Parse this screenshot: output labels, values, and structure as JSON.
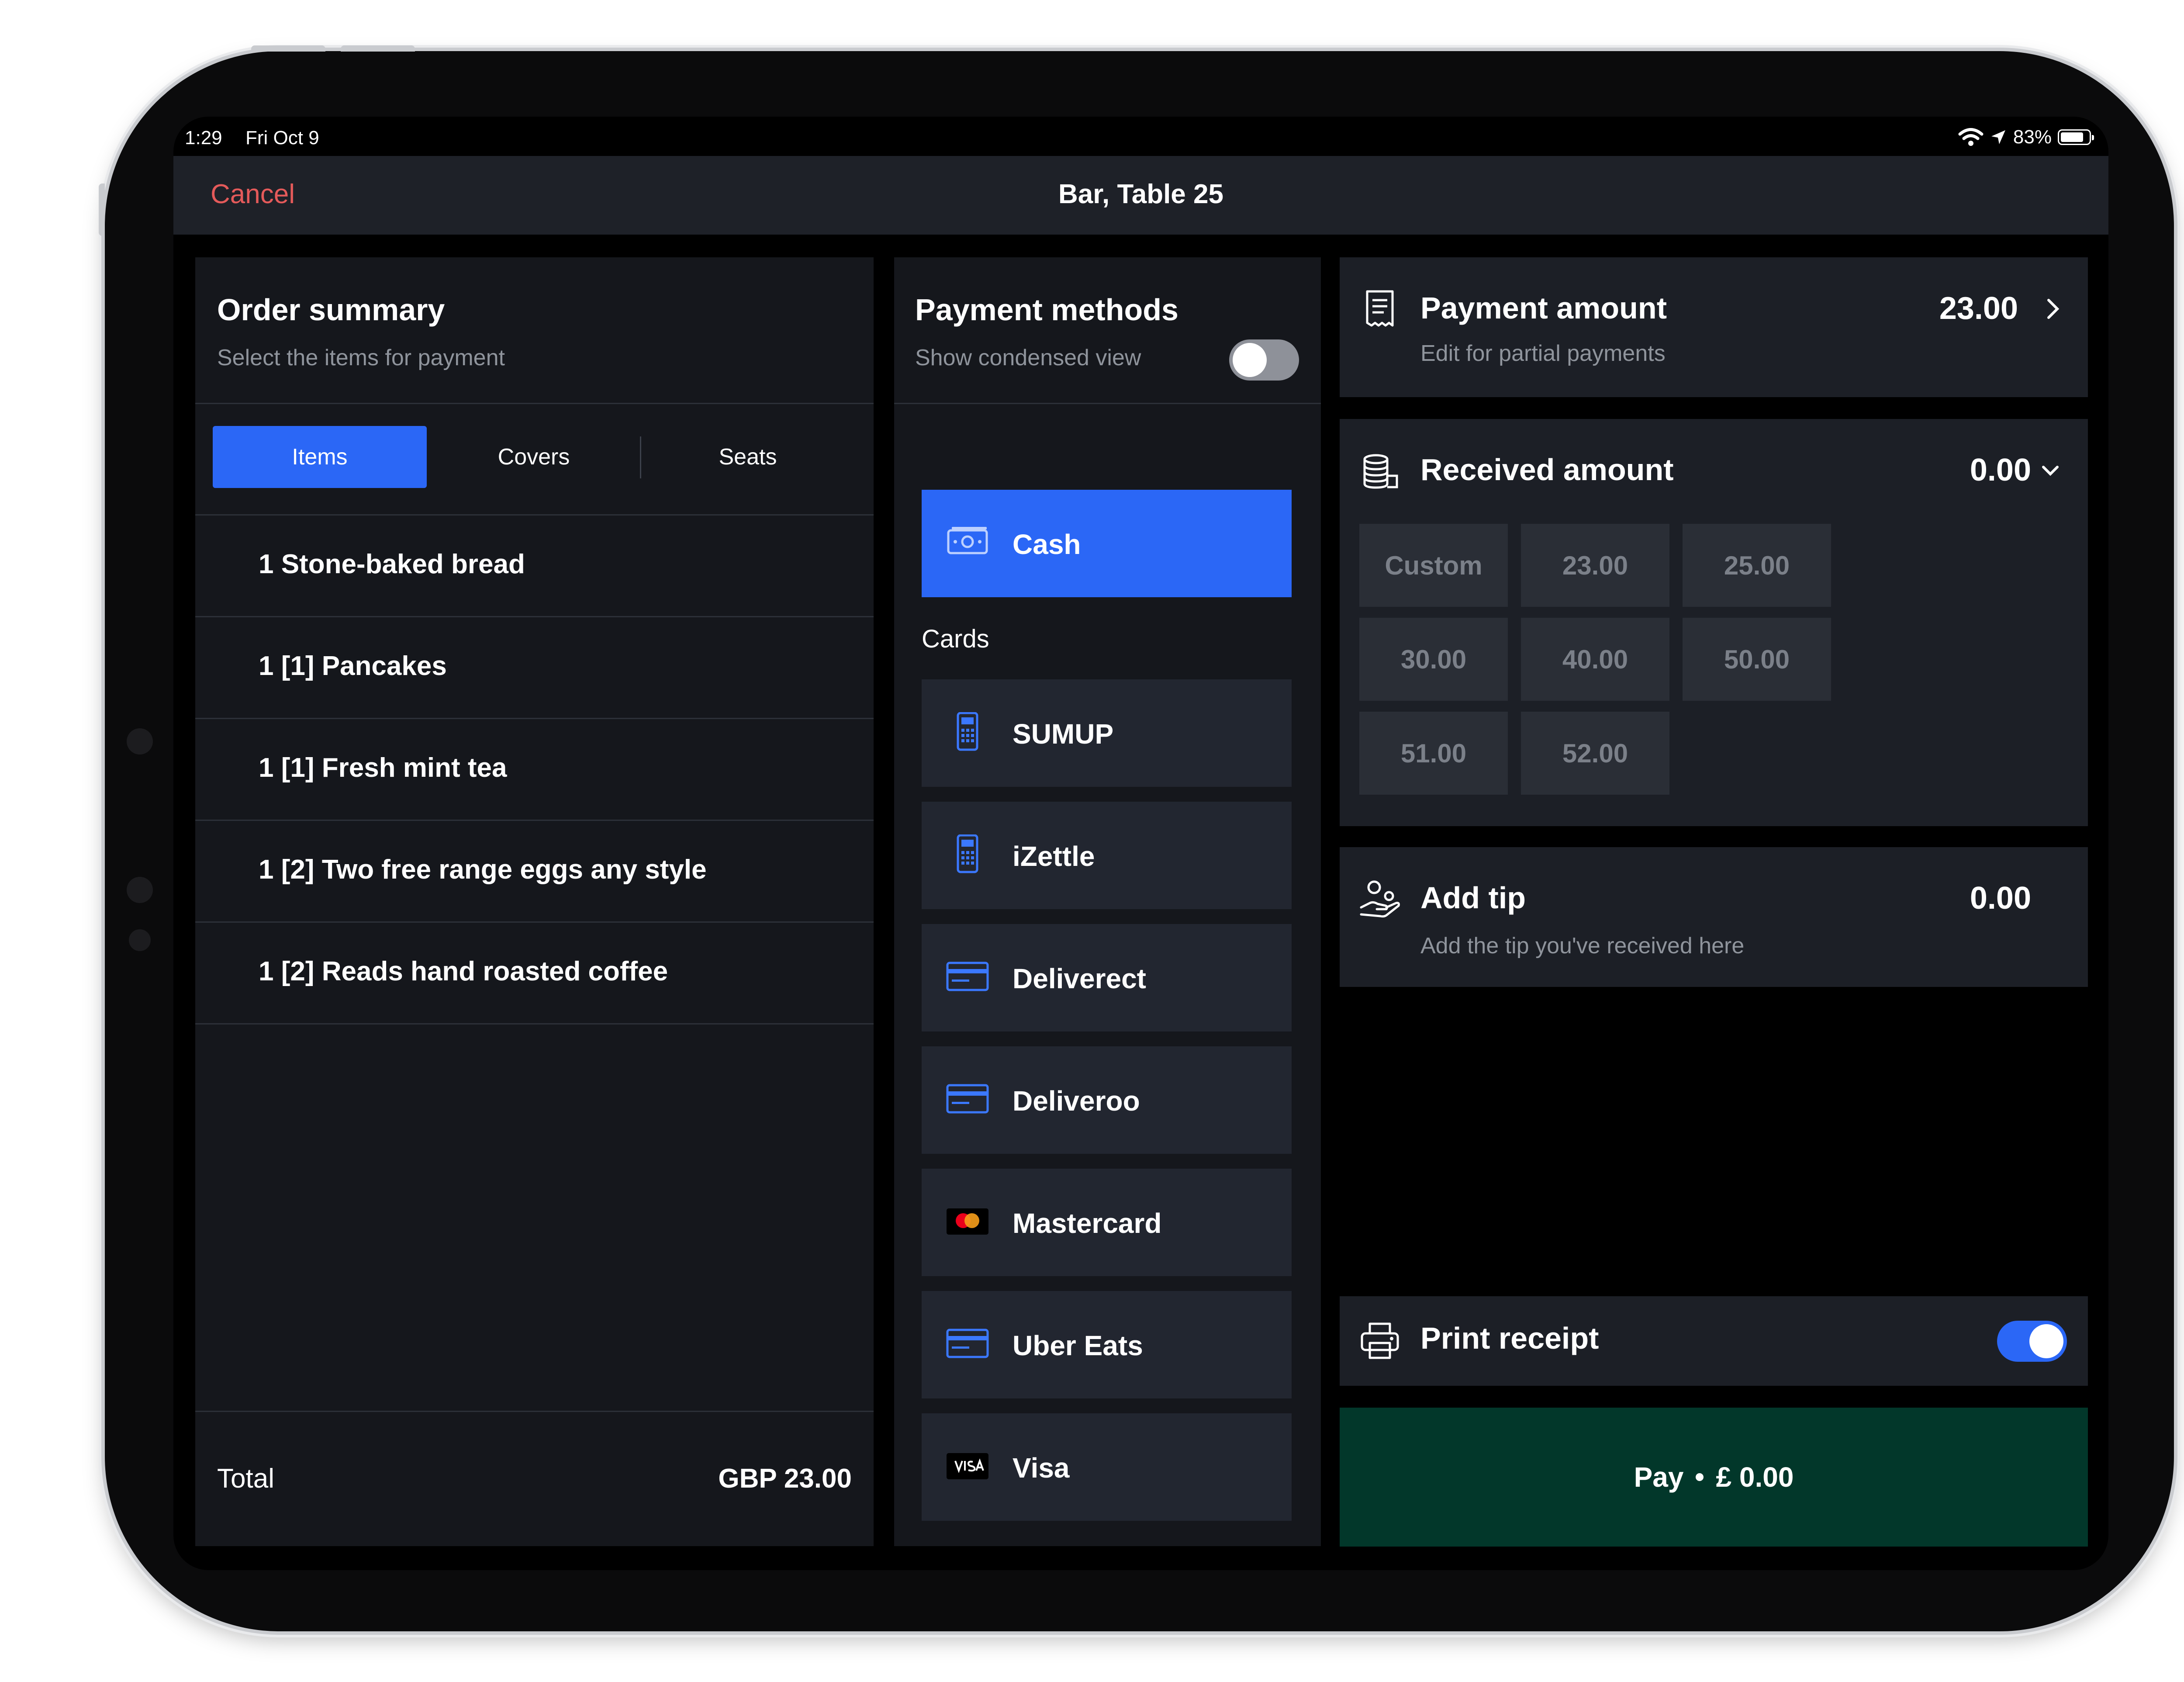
{
  "status_bar": {
    "time": "1:29",
    "date": "Fri Oct 9",
    "battery": "83%",
    "battery_level": 0.83
  },
  "nav": {
    "cancel": "Cancel",
    "title": "Bar, Table 25"
  },
  "order_summary": {
    "title": "Order summary",
    "subtitle": "Select the items for payment",
    "tabs": [
      {
        "label": "Items",
        "active": true
      },
      {
        "label": "Covers",
        "active": false
      },
      {
        "label": "Seats",
        "active": false
      }
    ],
    "items": [
      "1  Stone-baked bread",
      "1  [1] Pancakes",
      "1  [1] Fresh mint tea",
      "1  [2] Two free range eggs any style",
      "1  [2] Reads hand roasted coffee"
    ],
    "total_label": "Total",
    "total_value": "GBP  23.00"
  },
  "payment_methods": {
    "title": "Payment methods",
    "condensed_label": "Show condensed view",
    "condensed_on": false,
    "cash": {
      "label": "Cash",
      "icon": "cash-icon",
      "selected": true
    },
    "cards_heading": "Cards",
    "cards": [
      {
        "label": "SUMUP",
        "icon": "card-terminal-icon"
      },
      {
        "label": "iZettle",
        "icon": "card-terminal-icon"
      },
      {
        "label": "Deliverect",
        "icon": "credit-card-icon"
      },
      {
        "label": "Deliveroo",
        "icon": "credit-card-icon"
      },
      {
        "label": "Mastercard",
        "icon": "mastercard-icon"
      },
      {
        "label": "Uber Eats",
        "icon": "credit-card-icon"
      },
      {
        "label": "Visa",
        "icon": "visa-icon"
      }
    ]
  },
  "payment_amount": {
    "label": "Payment amount",
    "value": "23.00",
    "sub": "Edit for partial payments"
  },
  "received_amount": {
    "label": "Received amount",
    "value": "0.00",
    "options": [
      "Custom",
      "23.00",
      "25.00",
      "30.00",
      "40.00",
      "50.00",
      "51.00",
      "52.00"
    ]
  },
  "tip": {
    "label": "Add tip",
    "value": "0.00",
    "sub": "Add the tip you've received here"
  },
  "print_receipt": {
    "label": "Print receipt",
    "on": true
  },
  "pay": {
    "label": "Pay",
    "amount": "£ 0.00"
  },
  "colors": {
    "accent": "#2b67f6",
    "cancel": "#e45a5a",
    "pay_button": "#02372a",
    "panel": "#15171c",
    "card": "#1c1f26"
  }
}
